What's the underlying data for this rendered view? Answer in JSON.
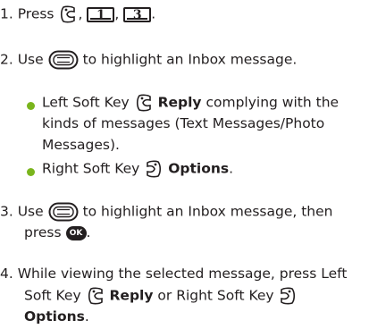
{
  "steps": {
    "s1": {
      "num": "1. Press",
      "sep1": ",",
      "key1": "1",
      "sep2": ",",
      "key2": "3",
      "end": "."
    },
    "s2": {
      "pre": "2. Use",
      "post": "to highlight an Inbox message."
    },
    "b1": {
      "pre": "Left Soft Key",
      "bold": "Reply",
      "post": "complying with the",
      "line2": "kinds of messages (Text Messages/Photo",
      "line3": "Messages)."
    },
    "b2": {
      "pre": "Right Soft Key",
      "bold": "Options",
      "end": "."
    },
    "s3": {
      "pre": "3. Use",
      "post": "to highlight an Inbox message, then",
      "line2": "press",
      "ok": "OK",
      "end": "."
    },
    "s4": {
      "line1": "4. While viewing the selected message, press Left",
      "line2a": "Soft Key",
      "line2b": "Reply",
      "line2c": "or Right Soft Key",
      "line3": "Options",
      "end": "."
    }
  },
  "icons": [
    "left-soft-key-icon",
    "right-soft-key-icon",
    "navigation-key-icon",
    "ok-key-icon"
  ],
  "colors": {
    "bullet": "#7ab51d",
    "text": "#231f20"
  }
}
